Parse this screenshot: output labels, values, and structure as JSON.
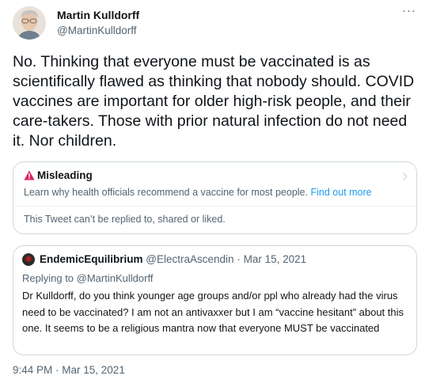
{
  "author": {
    "name": "Martin Kulldorff",
    "handle": "@MartinKulldorff"
  },
  "more_menu_label": "···",
  "tweet_text": "No. Thinking that everyone must be vaccinated is as scientifically flawed as thinking that nobody should. COVID vaccines are important for older high-risk people, and their care-takers. Those with prior natural infection do not need it. Nor children.",
  "misleading_card": {
    "title": "Misleading",
    "description": "Learn why health officials recommend a vaccine for most people.",
    "link": "Find out more",
    "restriction": "This Tweet can’t be replied to, shared or liked.",
    "warning_color": "#e0245e"
  },
  "quote": {
    "name": "EndemicEquilibrium",
    "handle": "@ElectraAscendin",
    "separator": "·",
    "date": "Mar 15, 2021",
    "replying_prefix": "Replying to ",
    "replying_to": "@MartinKulldorff",
    "text": "Dr Kulldorff, do you think younger age groups and/or ppl who already had the virus need to be vaccinated? I am not an antivaxxer but I am “vaccine hesitant” about this one. It seems to be a religious mantra now that everyone MUST be vaccinated"
  },
  "timestamp": "9:44 PM · Mar 15, 2021",
  "colors": {
    "text_primary": "#0f1419",
    "text_secondary": "#536471",
    "link": "#1d9bf0",
    "border": "#cfd9de"
  }
}
